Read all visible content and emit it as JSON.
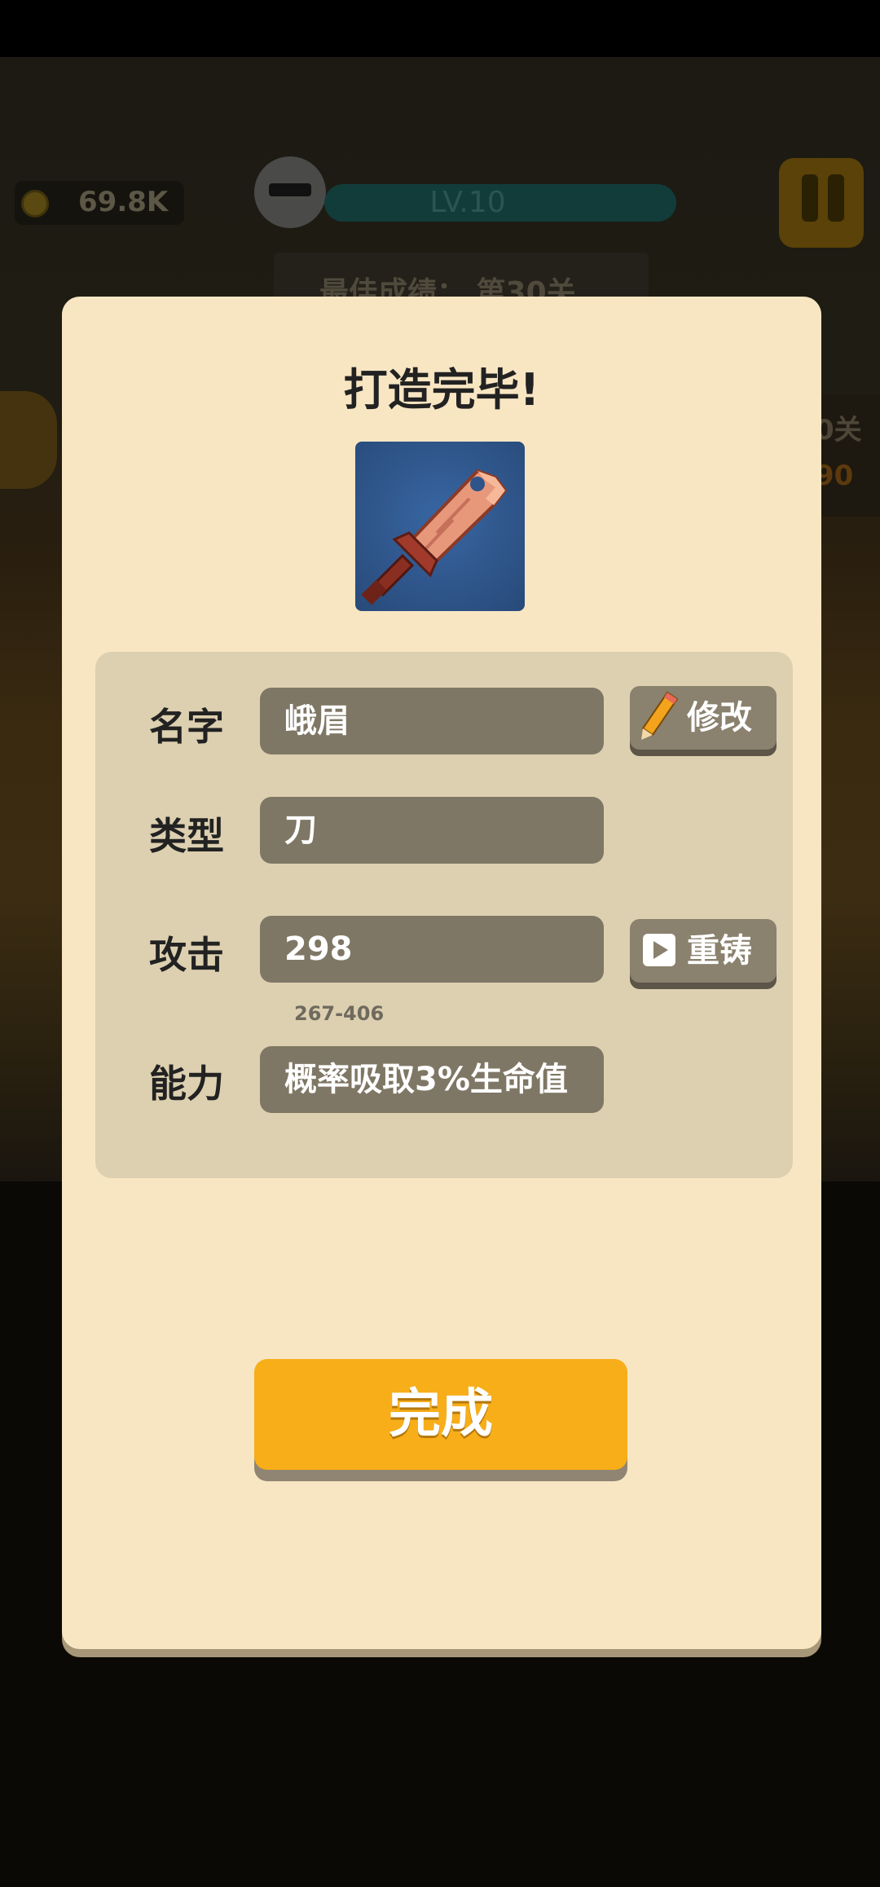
{
  "hud": {
    "coins": "69.8K",
    "level": "LV.10",
    "best_record": "最佳成绩：  第30关",
    "side_level_fragment": "0关",
    "side_number_fragment": "90"
  },
  "dialog": {
    "title": "打造完毕!",
    "weapon_icon": "broadsword-icon",
    "rows": {
      "name": {
        "label": "名字",
        "value": "峨眉",
        "button": "修改",
        "button_icon": "pencil-icon"
      },
      "type": {
        "label": "类型",
        "value": "刀"
      },
      "attack": {
        "label": "攻击",
        "value": "298",
        "range": "267-406",
        "button": "重铸",
        "button_icon": "play-video-icon"
      },
      "ability": {
        "label": "能力",
        "value": "概率吸取3%生命值"
      }
    },
    "done_button": "完成"
  },
  "colors": {
    "dialog_bg": "#f8e6c3",
    "panel_bg": "#ddd0b0",
    "field_bg": "#7f7765",
    "accent_orange": "#f7ae19",
    "weapon_frame": "#2e5489"
  }
}
